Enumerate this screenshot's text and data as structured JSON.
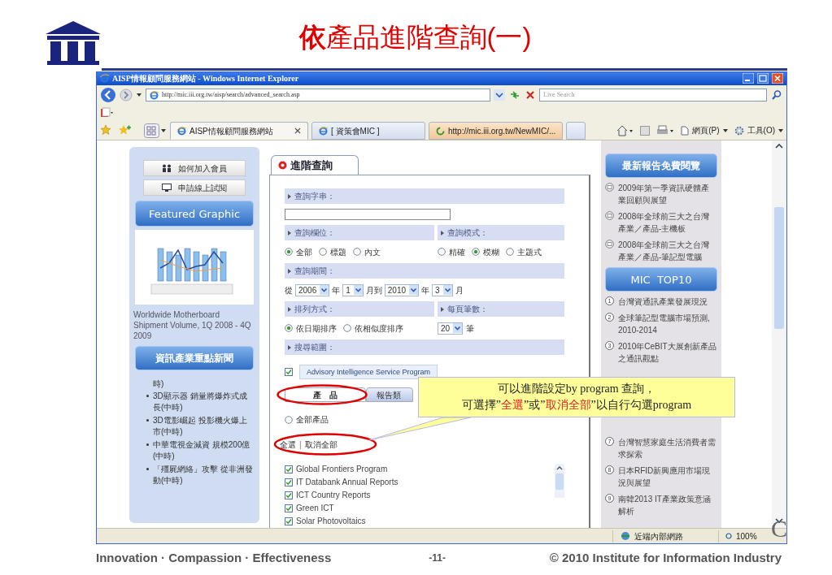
{
  "slide": {
    "title_emphasis": "依",
    "title_rest": "產品進階查詢(一)",
    "footer_motto": "Innovation · Compassion · Effectiveness",
    "page_number": "-11-",
    "copyright": "© 2010 Institute for Information Industry",
    "corner_letter": "C"
  },
  "browser": {
    "title": "AISP情報顧問服務網站 - Windows Internet Explorer",
    "address": "http://mic.iii.org.tw/aisp/search/advanced_search.asp",
    "search_placeholder": "Live Search",
    "tabs": [
      {
        "label": "AISP情報顧問服務網站",
        "selected": true,
        "kind": "page"
      },
      {
        "label": "[ 資策會MIC ]",
        "selected": false,
        "kind": "page"
      },
      {
        "label": "http://mic.iii.org.tw/NewMIC/...",
        "selected": false,
        "kind": "loading"
      }
    ],
    "toolbar": [
      "網頁(P)",
      "工具(O)"
    ],
    "status": {
      "zone": "近端內部網路",
      "zoom": "100%"
    }
  },
  "left": {
    "buttons": [
      {
        "label": "如何加入會員",
        "kind": "members"
      },
      {
        "label": "申請線上試閱",
        "kind": "screen"
      }
    ],
    "featured_title": "Featured Graphic",
    "featured_caption": "Worldwide Motherboard Shipment Volume, 1Q 2008 - 4Q 2009",
    "news_title": "資訊產業重點新聞",
    "news_cut": "時)",
    "news": [
      "3D顯示器 銷量將爆炸式成長(中時)",
      "3D電影崛起 投影機火爆上市(中時)",
      "中華電視金減資 規模200億(中時)",
      "「殭屍網絡」攻擊 從非洲發動(中時)"
    ]
  },
  "form": {
    "tab": "進階查詢",
    "query_label": "查詢字串：",
    "field_label": "查詢欄位：",
    "mode_label": "查詢模式：",
    "field_options": [
      {
        "label": "全部",
        "selected": true
      },
      {
        "label": "標題",
        "selected": false
      },
      {
        "label": "內文",
        "selected": false
      }
    ],
    "mode_options": [
      {
        "label": "精確",
        "selected": false
      },
      {
        "label": "模糊",
        "selected": true
      },
      {
        "label": "主題式",
        "selected": false
      }
    ],
    "period_label": "查詢期間：",
    "period": [
      {
        "kind": "text",
        "text": "從"
      },
      {
        "kind": "select",
        "text": "2006"
      },
      {
        "kind": "text",
        "text": "年"
      },
      {
        "kind": "select",
        "text": "1"
      },
      {
        "kind": "text",
        "text": "月到"
      },
      {
        "kind": "select",
        "text": "2010"
      },
      {
        "kind": "text",
        "text": "年"
      },
      {
        "kind": "select",
        "text": "3"
      },
      {
        "kind": "text",
        "text": "月"
      }
    ],
    "sort_label": "排列方式：",
    "per_page_label": "每頁筆數：",
    "sort_options": [
      {
        "label": "依日期排序",
        "selected": true
      },
      {
        "label": "依相似度排序",
        "selected": false
      }
    ],
    "per_page": {
      "value": "20",
      "unit": "筆"
    },
    "scope_label": "搜尋範圍：",
    "program": {
      "label": "Advisory Intelligence Service Program",
      "checked": true
    },
    "subtabs": [
      {
        "label": "產　品",
        "selected": true
      },
      {
        "label": "報告類",
        "selected": false
      }
    ],
    "all_products": {
      "label": "全部產品",
      "selected": false
    },
    "select_all": "全選",
    "link_separator": "|",
    "deselect_all": "取消全部",
    "programs": [
      {
        "label": "Global Frontiers Program",
        "checked": true
      },
      {
        "label": "IT Databank Annual Reports",
        "checked": true
      },
      {
        "label": "ICT Country Reports",
        "checked": true
      },
      {
        "label": "Green ICT",
        "checked": true
      },
      {
        "label": "Solar Photovoltaics",
        "checked": true
      }
    ]
  },
  "right": {
    "latest_title": "最新報告免費閱覽",
    "latest": [
      "2009年第一季資訊硬體產業回顧與展望",
      "2008年全球前三大之台灣產業／產品-主機板",
      "2008年全球前三大之台灣產業／產品-筆記型電腦"
    ],
    "top_title": "MIC  TOP10",
    "top": [
      {
        "number": "1",
        "text": "台灣資通訊產業發展現況"
      },
      {
        "number": "2",
        "text": "全球筆記型電腦市場預測, 2010-2014"
      },
      {
        "number": "3",
        "text": "2010年CeBIT大展創新產品之通訊觀點"
      }
    ],
    "top_continued": [
      {
        "number": "7",
        "text": "台灣智慧家庭生活消費者需求探索"
      },
      {
        "number": "8",
        "text": "日本RFID新興應用市場現況與展望"
      },
      {
        "number": "9",
        "text": "南韓2013 IT產業政策意涵解析"
      }
    ]
  },
  "annotation": {
    "line_1": "可以進階設定by program 查詢，",
    "line_2": [
      {
        "text": "可選擇”",
        "emphasis": false
      },
      {
        "text": "全選",
        "emphasis": true
      },
      {
        "text": "”或”",
        "emphasis": false
      },
      {
        "text": "取消全部",
        "emphasis": true
      },
      {
        "text": "”以自行勾選program",
        "emphasis": false
      }
    ]
  }
}
